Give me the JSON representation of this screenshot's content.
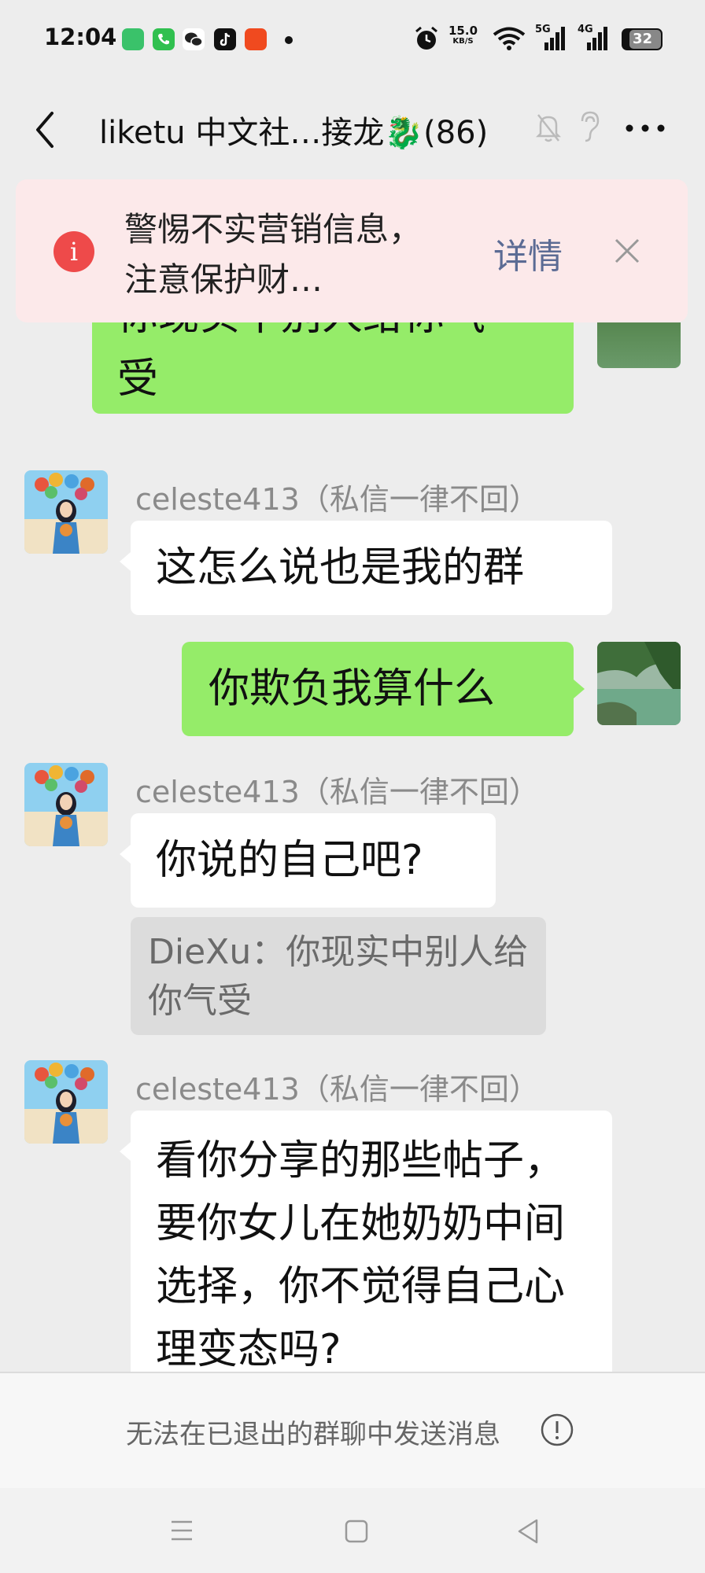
{
  "status_bar": {
    "time": "12:04",
    "network_speed": "15.0",
    "network_unit": "KB/S",
    "signal_1": "5G",
    "signal_2": "4G",
    "battery": "32"
  },
  "header": {
    "title": "liketu 中文社…接龙🐉(86)",
    "back_icon": "chevron-left-icon",
    "mute_icon": "bell-muted-icon",
    "ear_icon": "ear-icon",
    "more_icon": "more-dots-icon"
  },
  "warning_banner": {
    "text": "警惕不实营销信息，注意保护财…",
    "detail_label": "详情",
    "close_icon": "close-icon",
    "accent": "#ee4a4a"
  },
  "messages": [
    {
      "from": "me",
      "text": "你现实中别人给你气受"
    },
    {
      "from": "celeste413",
      "nickname": "celeste413（私信一律不回）",
      "text": "这怎么说也是我的群"
    },
    {
      "from": "me",
      "text": "你欺负我算什么"
    },
    {
      "from": "celeste413",
      "nickname": "celeste413（私信一律不回）",
      "text": "你说的自己吧?",
      "quote": "DieXu：你现实中别人给你气受"
    },
    {
      "from": "celeste413",
      "nickname": "celeste413（私信一律不回）",
      "text": "看你分享的那些帖子，要你女儿在她奶奶中间选择，你不觉得自己心理变态吗?"
    }
  ],
  "bottom": {
    "notice": "无法在已退出的群聊中发送消息",
    "notice_icon": "exclamation-circle-icon"
  },
  "colors": {
    "my_bubble": "#95ec69",
    "their_bubble": "#ffffff",
    "banner_bg": "#fce9ea",
    "link": "#5b6b94"
  }
}
